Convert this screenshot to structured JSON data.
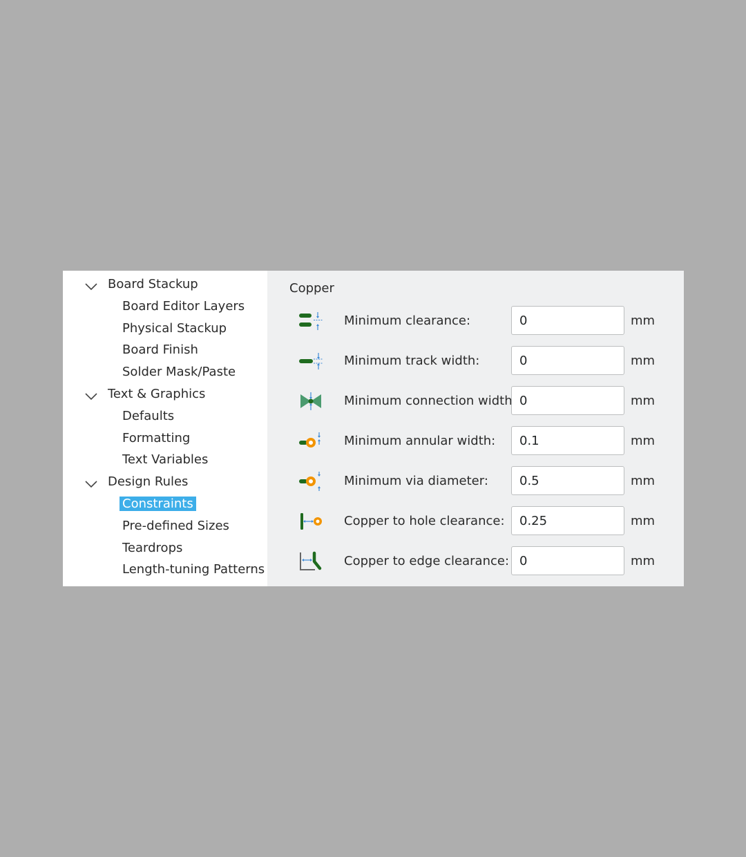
{
  "tree": {
    "items": [
      {
        "label": "Board Stackup",
        "level": 0,
        "expanded": true,
        "selected": false
      },
      {
        "label": "Board Editor Layers",
        "level": 1,
        "selected": false
      },
      {
        "label": "Physical Stackup",
        "level": 1,
        "selected": false
      },
      {
        "label": "Board Finish",
        "level": 1,
        "selected": false
      },
      {
        "label": "Solder Mask/Paste",
        "level": 1,
        "selected": false
      },
      {
        "label": "Text & Graphics",
        "level": 0,
        "expanded": true,
        "selected": false
      },
      {
        "label": "Defaults",
        "level": 1,
        "selected": false
      },
      {
        "label": "Formatting",
        "level": 1,
        "selected": false
      },
      {
        "label": "Text Variables",
        "level": 1,
        "selected": false
      },
      {
        "label": "Design Rules",
        "level": 0,
        "expanded": true,
        "selected": false
      },
      {
        "label": "Constraints",
        "level": 1,
        "selected": true
      },
      {
        "label": "Pre-defined Sizes",
        "level": 1,
        "selected": false
      },
      {
        "label": "Teardrops",
        "level": 1,
        "selected": false
      },
      {
        "label": "Length-tuning Patterns",
        "level": 1,
        "selected": false
      }
    ]
  },
  "copper": {
    "title": "Copper",
    "rows": [
      {
        "label": "Minimum clearance:",
        "value": "0",
        "unit": "mm",
        "icon": "clearance-icon"
      },
      {
        "label": "Minimum track width:",
        "value": "0",
        "unit": "mm",
        "icon": "track-width-icon"
      },
      {
        "label": "Minimum connection width:",
        "value": "0",
        "unit": "mm",
        "icon": "connection-width-icon"
      },
      {
        "label": "Minimum annular width:",
        "value": "0.1",
        "unit": "mm",
        "icon": "annular-width-icon"
      },
      {
        "label": "Minimum via diameter:",
        "value": "0.5",
        "unit": "mm",
        "icon": "via-diameter-icon"
      },
      {
        "label": "Copper to hole clearance:",
        "value": "0.25",
        "unit": "mm",
        "icon": "hole-clearance-icon"
      },
      {
        "label": "Copper to edge clearance:",
        "value": "0",
        "unit": "mm",
        "icon": "edge-clearance-icon"
      }
    ]
  },
  "colors": {
    "selection": "#3daee9",
    "track": "#1f6b1f",
    "via": "#f29400",
    "dimension": "#3d8ad8"
  }
}
